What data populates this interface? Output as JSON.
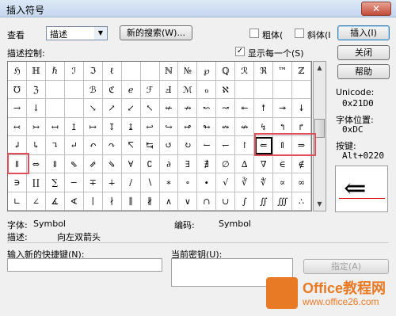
{
  "window": {
    "title": "插入符号",
    "close_glyph": "✕"
  },
  "view": {
    "label": "查看",
    "value": "描述"
  },
  "search_button": "新的搜索(W)...",
  "bold": {
    "label": "粗体(",
    "checked": false
  },
  "italic": {
    "label": "斜体(I",
    "checked": false
  },
  "buttons": {
    "insert": "插入(I)",
    "close": "关闭",
    "help": "帮助",
    "assign": "指定(A)"
  },
  "desc_control_label": "描述控制:",
  "show_each": {
    "label": "显示每一个(S)",
    "checked": true
  },
  "symbols": [
    [
      "ℌ",
      "ℍ",
      "ℏ",
      "ℐ",
      "ℑ",
      "ℓ",
      "",
      "",
      "ℕ",
      "№",
      "℘",
      "ℚ",
      "ℛ",
      "ℜ",
      "™",
      "ℤ"
    ],
    [
      "℧",
      "ℨ",
      "",
      "",
      "ℬ",
      "ℭ",
      "ℯ",
      "ℱ",
      "Ⅎ",
      "ℳ",
      "ℴ",
      "ℵ",
      "",
      "",
      "",
      ""
    ],
    [
      "→",
      "↓",
      "",
      "",
      "↘",
      "↗",
      "↙",
      "↖",
      "↚",
      "↛",
      "↜",
      "↝",
      "↞",
      "↟",
      "↠",
      "↡"
    ],
    [
      "↢",
      "↣",
      "↤",
      "↥",
      "↦",
      "↧",
      "↨",
      "↩",
      "↪",
      "↫",
      "↬",
      "↭",
      "↮",
      "↯",
      "↰",
      "↱"
    ],
    [
      "↲",
      "↳",
      "↴",
      "↵",
      "↶",
      "↷",
      "↸",
      "↹",
      "↺",
      "↻",
      "↼",
      "↽",
      "↾",
      "⇐",
      "⇑",
      "⇒"
    ],
    [
      "⇓",
      "⇔",
      "⇕",
      "⇖",
      "⇗",
      "⇘",
      "∀",
      "∁",
      "∂",
      "∃",
      "∄",
      "∅",
      "∆",
      "∇",
      "∈",
      "∉"
    ],
    [
      "∋",
      "∐",
      "∑",
      "−",
      "∓",
      "∔",
      "∕",
      "∖",
      "∗",
      "∘",
      "∙",
      "√",
      "∛",
      "∜",
      "∝",
      "∞"
    ],
    [
      "∟",
      "∠",
      "∡",
      "∢",
      "∣",
      "∤",
      "∥",
      "∦",
      "∧",
      "∨",
      "∩",
      "∪",
      "∫",
      "∬",
      "∭",
      "∴"
    ]
  ],
  "unicode": {
    "label": "Unicode:",
    "value": "0x21D0"
  },
  "font_pos": {
    "label": "字体位置:",
    "value": "0xDC"
  },
  "keystroke": {
    "label": "按键:",
    "value": "Alt+0220"
  },
  "preview_glyph": "⇐",
  "font_info": {
    "label": "字体:",
    "value": "Symbol"
  },
  "code_info": {
    "label": "编码:",
    "value": "Symbol"
  },
  "desc_info": {
    "label": "描述:",
    "value": "向左双箭头"
  },
  "new_shortcut_label": "输入新的快捷键(N):",
  "current_key_label": "当前密钥(U):",
  "watermark": {
    "line1": "Office教程网",
    "line2": "www.office26.com"
  }
}
